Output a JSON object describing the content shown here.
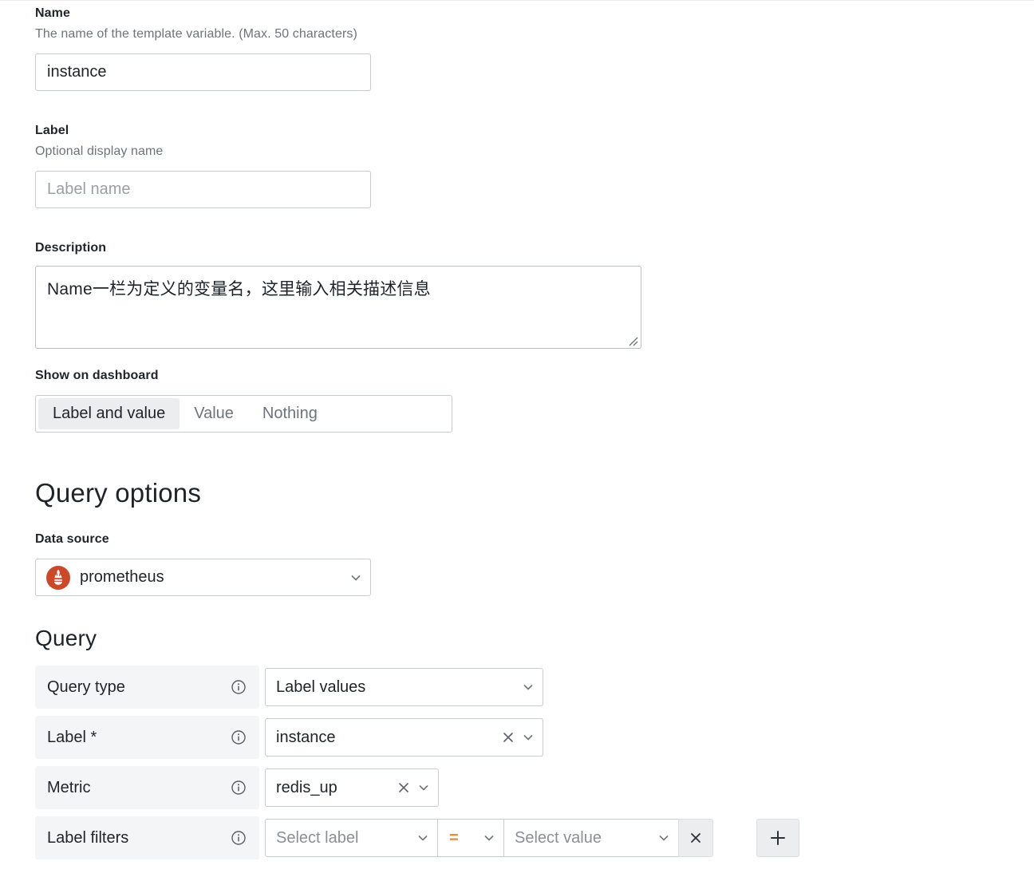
{
  "colors": {
    "accent_orange": "#e08a3c",
    "prometheus_red": "#cc4828",
    "panel_gray": "#f4f5f6",
    "selected_pill": "#ebedef",
    "border": "#c7ccd1",
    "text": "#1f242b",
    "muted_text": "#6c747d",
    "placeholder": "#8a9097"
  },
  "name_field": {
    "label": "Name",
    "description": "The name of the template variable. (Max. 50 characters)",
    "value": "instance"
  },
  "label_field": {
    "label": "Label",
    "description": "Optional display name",
    "value": "",
    "placeholder": "Label name"
  },
  "description_field": {
    "label": "Description",
    "value": "Name一栏为定义的变量名，这里输入相关描述信息"
  },
  "show_on_dashboard": {
    "label": "Show on dashboard",
    "options": [
      {
        "label": "Label and value",
        "selected": true
      },
      {
        "label": "Value",
        "selected": false
      },
      {
        "label": "Nothing",
        "selected": false
      }
    ]
  },
  "query_options": {
    "heading": "Query options",
    "data_source": {
      "label": "Data source",
      "value": "prometheus",
      "logo": "prometheus-logo"
    }
  },
  "query": {
    "heading": "Query",
    "rows": [
      {
        "label": "Query type",
        "info_icon": "info-icon",
        "value": "Label values",
        "chevron_icon": "chevron-down-icon"
      },
      {
        "label": "Label *",
        "info_icon": "info-icon",
        "value": "instance",
        "clear_icon": "close-icon",
        "chevron_icon": "chevron-down-icon"
      },
      {
        "label": "Metric",
        "info_icon": "info-icon",
        "value": "redis_up",
        "clear_icon": "close-icon",
        "chevron_icon": "chevron-down-icon"
      }
    ],
    "label_filters": {
      "label": "Label filters",
      "info_icon": "info-icon",
      "select_label_placeholder": "Select label",
      "operator": "=",
      "select_value_placeholder": "Select value",
      "remove_label": "×",
      "add_label": "+"
    }
  }
}
